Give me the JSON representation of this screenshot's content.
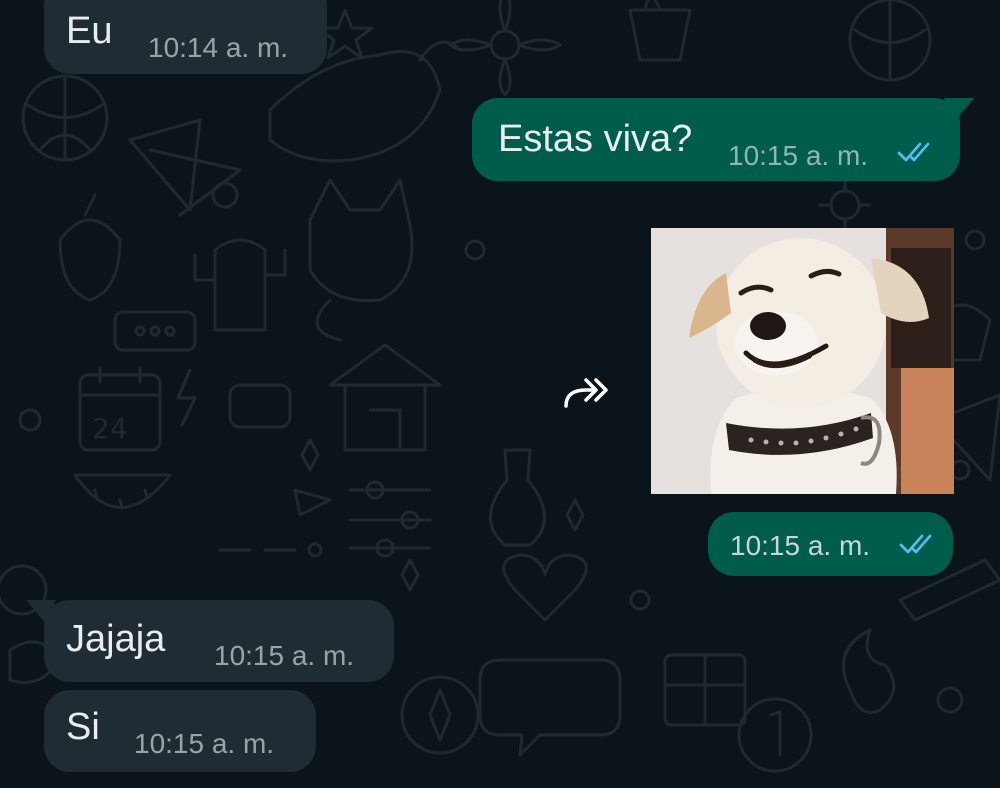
{
  "messages": [
    {
      "id": "m1",
      "direction": "incoming",
      "text": "Eu",
      "time": "10:14 a. m."
    },
    {
      "id": "m2",
      "direction": "outgoing",
      "text": "Estas viva?",
      "time": "10:15 a. m.",
      "status": "read"
    },
    {
      "id": "m3",
      "direction": "outgoing",
      "type": "sticker",
      "sticker": "smiling-dog",
      "time": "10:15 a. m.",
      "status": "read"
    },
    {
      "id": "m4",
      "direction": "incoming",
      "text": "Jajaja",
      "time": "10:15 a. m."
    },
    {
      "id": "m5",
      "direction": "incoming",
      "text": "Si",
      "time": "10:15 a. m."
    }
  ],
  "icons": {
    "read_receipt": "double-check-icon",
    "forward": "forward-icon"
  },
  "colors": {
    "background": "#0b141a",
    "incoming_bubble": "#202c33",
    "outgoing_bubble": "#005c4b",
    "read_tick": "#53bdeb",
    "text": "#e9edef"
  }
}
